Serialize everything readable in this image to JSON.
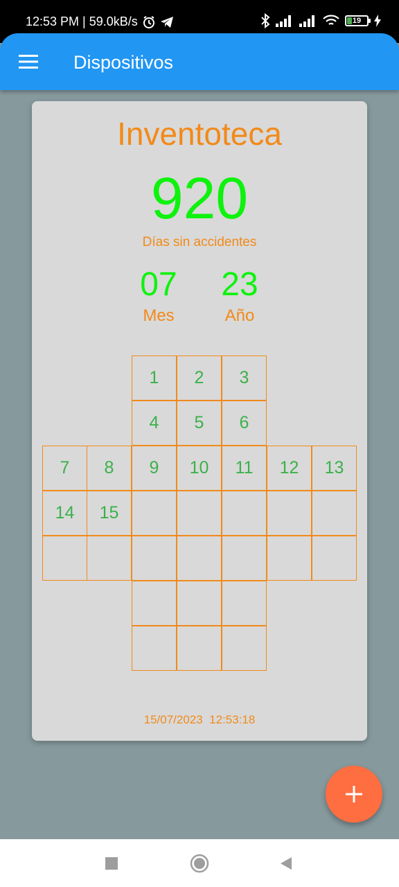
{
  "status_bar": {
    "time_speed": "12:53 PM | 59.0kB/s",
    "battery_level": "19",
    "icons": [
      "alarm-icon",
      "telegram-icon",
      "bluetooth-icon",
      "signal-icon",
      "signal-icon",
      "wifi-icon",
      "battery-icon",
      "charging-icon"
    ]
  },
  "app_bar": {
    "title": "Dispositivos",
    "menu_icon": "menu-icon",
    "color": "#2196f3"
  },
  "card": {
    "brand": "Inventoteca",
    "days": "920",
    "days_label": "Días sin accidentes",
    "month_value": "07",
    "month_label": "Mes",
    "year_value": "23",
    "year_label": "Año",
    "timestamp": "15/07/2023  12:53:18",
    "grid_rows": [
      [
        "",
        "",
        "1",
        "2",
        "3",
        "",
        ""
      ],
      [
        "",
        "",
        "4",
        "5",
        "6",
        "",
        ""
      ],
      [
        "7",
        "8",
        "9",
        "10",
        "11",
        "12",
        "13"
      ],
      [
        "14",
        "15",
        "",
        "",
        "",
        "",
        ""
      ],
      [
        "",
        "",
        "",
        "",
        "",
        "",
        ""
      ],
      [
        "",
        "",
        "",
        "",
        "",
        "",
        ""
      ],
      [
        "",
        "",
        "",
        "",
        "",
        "",
        ""
      ]
    ],
    "accent_color": "#f18a19",
    "value_color": "#0ef20e",
    "cell_number_color": "#3cb04a"
  },
  "fab": {
    "icon": "plus-icon",
    "color": "#ff6e40"
  },
  "nav_bar": {
    "icons": [
      "recents-square-icon",
      "home-circle-icon",
      "back-triangle-icon"
    ]
  }
}
